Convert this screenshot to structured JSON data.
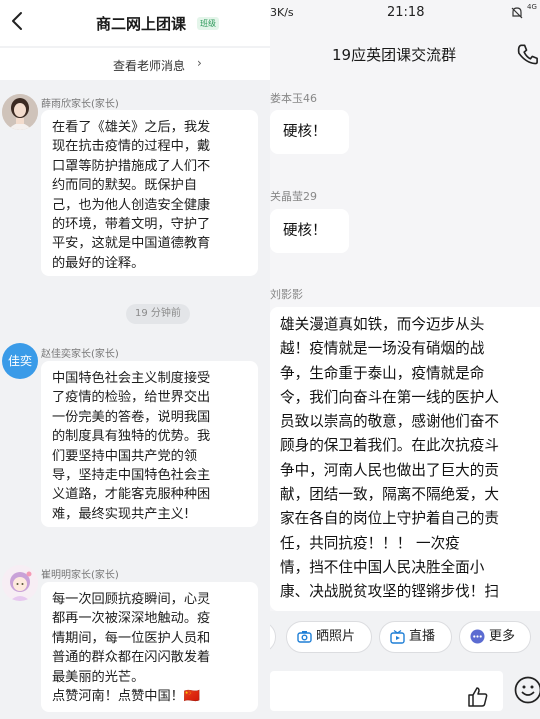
{
  "left": {
    "title": "商二网上团课",
    "badge": "班级",
    "notice": "查看老师消息",
    "notice_chevron": "›",
    "time_divider": "19 分钟前",
    "messages": [
      {
        "sender": "薛雨欣家长(家长)",
        "avatar": "girl-photo-avatar",
        "lines": [
          "在看了《雄关》之后，我发",
          "现在抗击疫情的过程中，戴",
          "口罩等防护措施成了人们不",
          "约而同的默契。既保护自",
          "己，也为他人创造安全健康",
          "的环境，带着文明，守护了",
          "平安，这就是中国道德教育",
          "的最好的诠释。"
        ]
      },
      {
        "sender": "赵佳奕家长(家长)",
        "avatar_text": "佳奕",
        "avatar_color": "#3a9be8",
        "lines": [
          "中国特色社会主义制度接受",
          "了疫情的检验，给世界交出",
          "一份完美的答卷，说明我国",
          "的制度具有独特的优势。我",
          "们要坚持中国共产党的领",
          "导，坚持走中国特色社会主",
          "义道路，才能客克服种种困",
          "难，最终实现共产主义!"
        ]
      },
      {
        "sender": "崔明明家长(家长)",
        "avatar": "cartoon-girl-avatar",
        "lines": [
          "每一次回顾抗疫瞬间，心灵",
          "都再一次被深深地触动。疫",
          "情期间，每一位医护人员和",
          "普通的群众都在闪闪散发着",
          "最美丽的光芒。",
          "点赞河南！点赞中国！🇨🇳"
        ]
      }
    ]
  },
  "right": {
    "speed": "3K/s",
    "time": "21:18",
    "status_right": "4G",
    "title": "19应英团课交流群",
    "messages": [
      {
        "sender": "娄本玉46",
        "text": "硬核！"
      },
      {
        "sender": "关晶莹29",
        "text": "硬核！"
      },
      {
        "sender": "刘影影",
        "lines": [
          "雄关漫道真如铁，而今迈步从头",
          "越！疫情就是一场没有硝烟的战",
          "争，生命重于泰山，疫情就是命",
          "令，我们向奋斗在第一线的医护人",
          "员致以崇高的敬意，感谢他们奋不",
          "顾身的保卫着我们。在此次抗疫斗",
          "争中，河南人民也做出了巨大的贡",
          "献，团结一致，隔离不隔绝爱，大",
          "家在各自的岗位上守护着自己的责",
          "任，共同抗疫！！！    一次疫",
          "情，挡不住中国人民决胜全面小",
          "康、决战脱贫攻坚的铿锵步伐！扫"
        ]
      }
    ],
    "chips": [
      "晒照片",
      "直播",
      "更多"
    ]
  },
  "colors": {
    "accent_green": "#2e9a5b",
    "avatar_blue": "#3a9be8",
    "chip_icon_blue": "#1f7fd6",
    "more_icon": "#5b6bd1"
  }
}
